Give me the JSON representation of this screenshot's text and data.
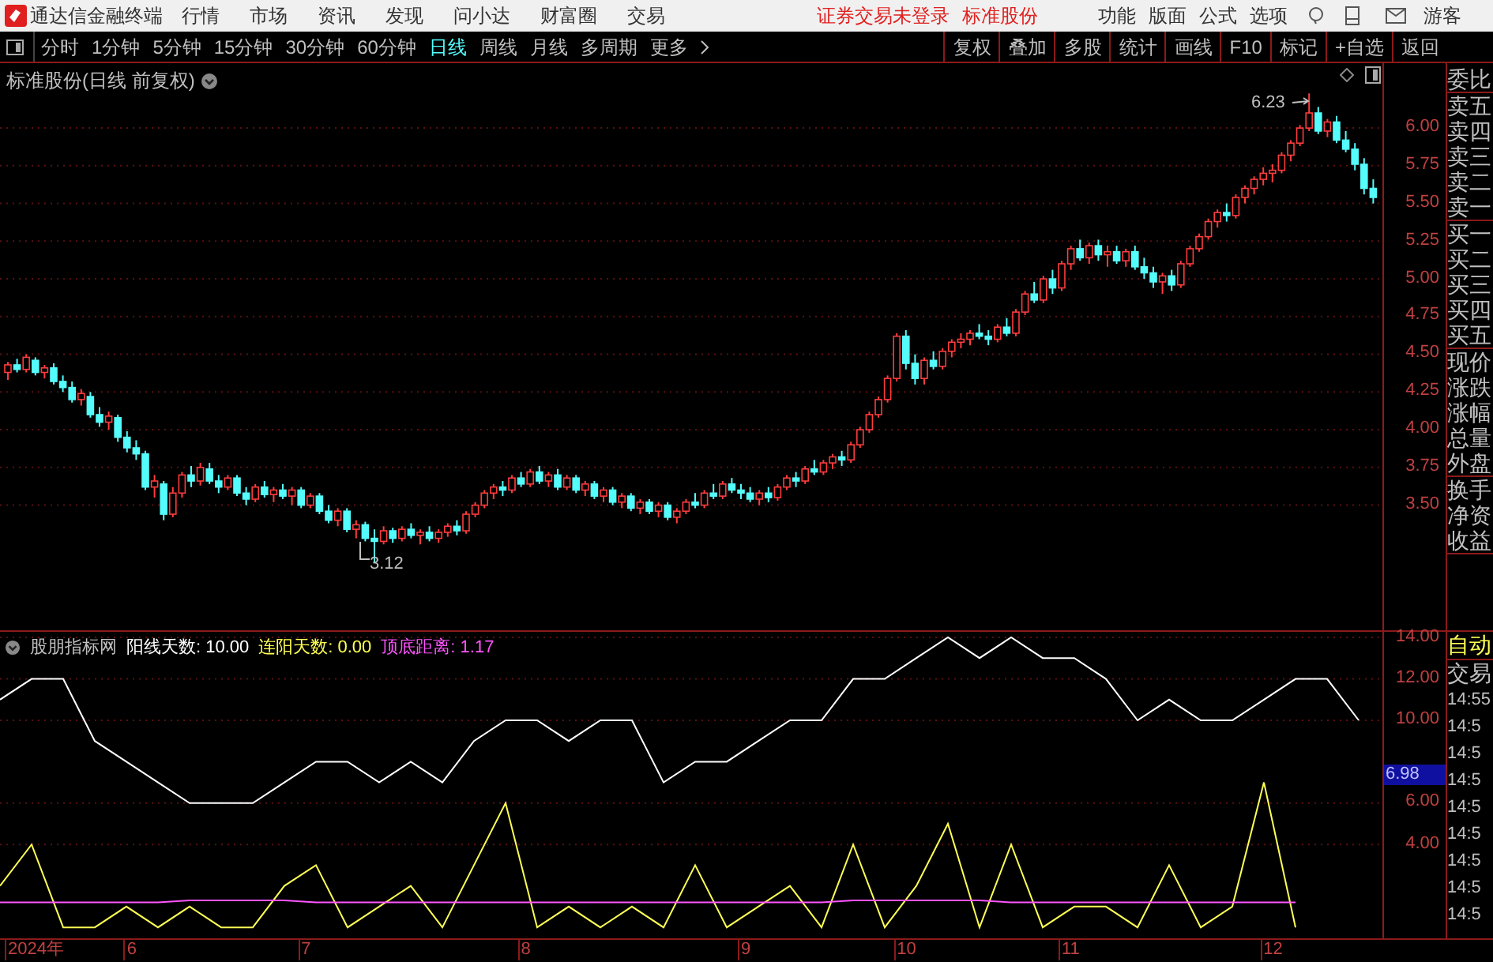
{
  "app": {
    "title": "通达信金融终端"
  },
  "menu": [
    "行情",
    "市场",
    "资讯",
    "发现",
    "问小达",
    "财富圈",
    "交易"
  ],
  "status": [
    "证券交易未登录",
    "标准股份"
  ],
  "right_menu": [
    "功能",
    "版面",
    "公式",
    "选项"
  ],
  "user": "游客",
  "periods": [
    {
      "label": "分时",
      "selected": false
    },
    {
      "label": "1分钟",
      "selected": false
    },
    {
      "label": "5分钟",
      "selected": false
    },
    {
      "label": "15分钟",
      "selected": false
    },
    {
      "label": "30分钟",
      "selected": false
    },
    {
      "label": "60分钟",
      "selected": false
    },
    {
      "label": "日线",
      "selected": true
    },
    {
      "label": "周线",
      "selected": false
    },
    {
      "label": "月线",
      "selected": false
    },
    {
      "label": "多周期",
      "selected": false
    },
    {
      "label": "更多",
      "selected": false
    }
  ],
  "toolbar_buttons": [
    "复权",
    "叠加",
    "多股",
    "统计",
    "画线",
    "F10",
    "标记",
    "+自选",
    "返回"
  ],
  "chart": {
    "title": "标准股份(日线 前复权)",
    "high_label": "6.23",
    "low_label": "3.12",
    "chart_data": {
      "type": "candlestick",
      "ylim": [
        2.66,
        6.43
      ],
      "grid": true,
      "yticks": [
        {
          "value": 6,
          "label": "6.00"
        },
        {
          "value": 5.75,
          "label": "5.75"
        },
        {
          "value": 5.5,
          "label": "5.50"
        },
        {
          "value": 5.25,
          "label": "5.25"
        },
        {
          "value": 5,
          "label": "5.00"
        },
        {
          "value": 4.75,
          "label": "4.75"
        },
        {
          "value": 4.5,
          "label": "4.50"
        },
        {
          "value": 4.25,
          "label": "4.25"
        },
        {
          "value": 4,
          "label": "4.00"
        },
        {
          "value": 3.75,
          "label": "3.75"
        },
        {
          "value": 3.5,
          "label": "3.50"
        }
      ],
      "ohlc": [
        [
          4.38,
          4.45,
          4.33,
          4.43
        ],
        [
          4.43,
          4.47,
          4.38,
          4.4
        ],
        [
          4.4,
          4.5,
          4.38,
          4.48
        ],
        [
          4.46,
          4.48,
          4.36,
          4.38
        ],
        [
          4.38,
          4.43,
          4.34,
          4.41
        ],
        [
          4.41,
          4.44,
          4.3,
          4.32
        ],
        [
          4.32,
          4.36,
          4.25,
          4.28
        ],
        [
          4.28,
          4.32,
          4.18,
          4.2
        ],
        [
          4.2,
          4.27,
          4.16,
          4.24
        ],
        [
          4.22,
          4.25,
          4.08,
          4.1
        ],
        [
          4.1,
          4.15,
          4.02,
          4.05
        ],
        [
          4.05,
          4.12,
          4.0,
          4.09
        ],
        [
          4.08,
          4.1,
          3.92,
          3.95
        ],
        [
          3.95,
          3.99,
          3.85,
          3.88
        ],
        [
          3.88,
          3.93,
          3.8,
          3.84
        ],
        [
          3.84,
          3.86,
          3.6,
          3.62
        ],
        [
          3.62,
          3.7,
          3.55,
          3.66
        ],
        [
          3.64,
          3.66,
          3.4,
          3.44
        ],
        [
          3.44,
          3.62,
          3.42,
          3.58
        ],
        [
          3.58,
          3.72,
          3.55,
          3.7
        ],
        [
          3.7,
          3.76,
          3.62,
          3.66
        ],
        [
          3.66,
          3.78,
          3.63,
          3.75
        ],
        [
          3.74,
          3.78,
          3.64,
          3.66
        ],
        [
          3.66,
          3.7,
          3.58,
          3.62
        ],
        [
          3.62,
          3.7,
          3.6,
          3.68
        ],
        [
          3.68,
          3.7,
          3.56,
          3.58
        ],
        [
          3.58,
          3.62,
          3.5,
          3.54
        ],
        [
          3.54,
          3.64,
          3.52,
          3.62
        ],
        [
          3.62,
          3.66,
          3.55,
          3.57
        ],
        [
          3.57,
          3.62,
          3.52,
          3.6
        ],
        [
          3.6,
          3.64,
          3.54,
          3.56
        ],
        [
          3.56,
          3.62,
          3.5,
          3.6
        ],
        [
          3.6,
          3.62,
          3.48,
          3.5
        ],
        [
          3.5,
          3.58,
          3.48,
          3.56
        ],
        [
          3.56,
          3.58,
          3.44,
          3.46
        ],
        [
          3.46,
          3.5,
          3.38,
          3.4
        ],
        [
          3.4,
          3.48,
          3.36,
          3.46
        ],
        [
          3.46,
          3.48,
          3.32,
          3.34
        ],
        [
          3.34,
          3.4,
          3.28,
          3.37
        ],
        [
          3.37,
          3.39,
          3.26,
          3.28
        ],
        [
          3.28,
          3.34,
          3.12,
          3.26
        ],
        [
          3.26,
          3.36,
          3.24,
          3.33
        ],
        [
          3.33,
          3.35,
          3.25,
          3.28
        ],
        [
          3.28,
          3.36,
          3.26,
          3.34
        ],
        [
          3.34,
          3.38,
          3.28,
          3.3
        ],
        [
          3.3,
          3.34,
          3.24,
          3.32
        ],
        [
          3.32,
          3.36,
          3.26,
          3.28
        ],
        [
          3.28,
          3.34,
          3.25,
          3.32
        ],
        [
          3.32,
          3.38,
          3.29,
          3.36
        ],
        [
          3.36,
          3.4,
          3.3,
          3.33
        ],
        [
          3.33,
          3.46,
          3.31,
          3.44
        ],
        [
          3.44,
          3.52,
          3.42,
          3.5
        ],
        [
          3.5,
          3.6,
          3.48,
          3.58
        ],
        [
          3.58,
          3.64,
          3.54,
          3.62
        ],
        [
          3.62,
          3.66,
          3.56,
          3.6
        ],
        [
          3.6,
          3.7,
          3.58,
          3.68
        ],
        [
          3.68,
          3.72,
          3.62,
          3.64
        ],
        [
          3.64,
          3.74,
          3.62,
          3.72
        ],
        [
          3.72,
          3.76,
          3.64,
          3.66
        ],
        [
          3.66,
          3.72,
          3.62,
          3.7
        ],
        [
          3.7,
          3.74,
          3.6,
          3.62
        ],
        [
          3.62,
          3.7,
          3.6,
          3.68
        ],
        [
          3.68,
          3.7,
          3.58,
          3.6
        ],
        [
          3.6,
          3.66,
          3.56,
          3.64
        ],
        [
          3.64,
          3.66,
          3.54,
          3.56
        ],
        [
          3.56,
          3.62,
          3.52,
          3.6
        ],
        [
          3.6,
          3.62,
          3.5,
          3.52
        ],
        [
          3.52,
          3.58,
          3.48,
          3.56
        ],
        [
          3.56,
          3.58,
          3.46,
          3.48
        ],
        [
          3.48,
          3.54,
          3.44,
          3.52
        ],
        [
          3.52,
          3.54,
          3.44,
          3.46
        ],
        [
          3.46,
          3.52,
          3.42,
          3.5
        ],
        [
          3.5,
          3.52,
          3.4,
          3.42
        ],
        [
          3.42,
          3.48,
          3.38,
          3.46
        ],
        [
          3.46,
          3.54,
          3.44,
          3.52
        ],
        [
          3.52,
          3.58,
          3.48,
          3.5
        ],
        [
          3.5,
          3.6,
          3.48,
          3.58
        ],
        [
          3.58,
          3.64,
          3.54,
          3.56
        ],
        [
          3.56,
          3.66,
          3.54,
          3.64
        ],
        [
          3.64,
          3.68,
          3.58,
          3.6
        ],
        [
          3.6,
          3.64,
          3.54,
          3.58
        ],
        [
          3.58,
          3.62,
          3.52,
          3.54
        ],
        [
          3.54,
          3.6,
          3.5,
          3.58
        ],
        [
          3.58,
          3.62,
          3.52,
          3.55
        ],
        [
          3.55,
          3.64,
          3.53,
          3.62
        ],
        [
          3.62,
          3.7,
          3.6,
          3.68
        ],
        [
          3.68,
          3.72,
          3.62,
          3.66
        ],
        [
          3.66,
          3.76,
          3.64,
          3.74
        ],
        [
          3.74,
          3.8,
          3.7,
          3.72
        ],
        [
          3.72,
          3.8,
          3.7,
          3.78
        ],
        [
          3.78,
          3.84,
          3.74,
          3.82
        ],
        [
          3.82,
          3.86,
          3.76,
          3.8
        ],
        [
          3.8,
          3.92,
          3.78,
          3.9
        ],
        [
          3.9,
          4.02,
          3.88,
          4.0
        ],
        [
          4.0,
          4.12,
          3.98,
          4.1
        ],
        [
          4.1,
          4.22,
          4.08,
          4.2
        ],
        [
          4.2,
          4.36,
          4.18,
          4.34
        ],
        [
          4.34,
          4.64,
          4.32,
          4.62
        ],
        [
          4.62,
          4.66,
          4.4,
          4.44
        ],
        [
          4.44,
          4.5,
          4.3,
          4.34
        ],
        [
          4.34,
          4.48,
          4.3,
          4.46
        ],
        [
          4.46,
          4.52,
          4.4,
          4.42
        ],
        [
          4.42,
          4.54,
          4.4,
          4.52
        ],
        [
          4.52,
          4.6,
          4.48,
          4.58
        ],
        [
          4.58,
          4.64,
          4.54,
          4.6
        ],
        [
          4.6,
          4.66,
          4.56,
          4.64
        ],
        [
          4.64,
          4.7,
          4.6,
          4.62
        ],
        [
          4.62,
          4.66,
          4.56,
          4.6
        ],
        [
          4.6,
          4.7,
          4.58,
          4.68
        ],
        [
          4.68,
          4.74,
          4.62,
          4.64
        ],
        [
          4.64,
          4.8,
          4.62,
          4.78
        ],
        [
          4.78,
          4.92,
          4.76,
          4.9
        ],
        [
          4.9,
          4.98,
          4.84,
          4.86
        ],
        [
          4.86,
          5.02,
          4.84,
          5.0
        ],
        [
          5.0,
          5.06,
          4.9,
          4.94
        ],
        [
          4.94,
          5.12,
          4.92,
          5.1
        ],
        [
          5.1,
          5.22,
          5.06,
          5.2
        ],
        [
          5.2,
          5.26,
          5.12,
          5.14
        ],
        [
          5.14,
          5.24,
          5.1,
          5.22
        ],
        [
          5.22,
          5.26,
          5.12,
          5.16
        ],
        [
          5.16,
          5.22,
          5.08,
          5.18
        ],
        [
          5.18,
          5.22,
          5.1,
          5.12
        ],
        [
          5.12,
          5.2,
          5.08,
          5.18
        ],
        [
          5.18,
          5.22,
          5.06,
          5.08
        ],
        [
          5.08,
          5.14,
          5.0,
          5.04
        ],
        [
          5.04,
          5.08,
          4.94,
          4.98
        ],
        [
          4.98,
          5.04,
          4.9,
          5.02
        ],
        [
          5.02,
          5.06,
          4.92,
          4.96
        ],
        [
          4.96,
          5.12,
          4.94,
          5.1
        ],
        [
          5.1,
          5.22,
          5.08,
          5.2
        ],
        [
          5.2,
          5.3,
          5.18,
          5.28
        ],
        [
          5.28,
          5.4,
          5.26,
          5.38
        ],
        [
          5.38,
          5.46,
          5.34,
          5.44
        ],
        [
          5.44,
          5.5,
          5.38,
          5.42
        ],
        [
          5.42,
          5.56,
          5.4,
          5.54
        ],
        [
          5.54,
          5.62,
          5.5,
          5.6
        ],
        [
          5.6,
          5.68,
          5.56,
          5.66
        ],
        [
          5.66,
          5.74,
          5.62,
          5.7
        ],
        [
          5.7,
          5.76,
          5.64,
          5.72
        ],
        [
          5.72,
          5.84,
          5.7,
          5.82
        ],
        [
          5.82,
          5.92,
          5.78,
          5.9
        ],
        [
          5.9,
          6.02,
          5.88,
          6.0
        ],
        [
          6.0,
          6.23,
          5.98,
          6.1
        ],
        [
          6.1,
          6.14,
          5.96,
          5.98
        ],
        [
          5.98,
          6.06,
          5.94,
          6.04
        ],
        [
          6.04,
          6.08,
          5.9,
          5.92
        ],
        [
          5.92,
          5.98,
          5.84,
          5.86
        ],
        [
          5.86,
          5.9,
          5.72,
          5.76
        ],
        [
          5.76,
          5.8,
          5.56,
          5.6
        ],
        [
          5.6,
          5.66,
          5.5,
          5.54
        ]
      ]
    }
  },
  "indicator": {
    "name": "股朋指标网",
    "legend": [
      {
        "label": "阳线天数: 10.00",
        "color": "#ffffff"
      },
      {
        "label": "连阳天数: 0.00",
        "color": "#ffff54"
      },
      {
        "label": "顶底距离: 1.17",
        "color": "#ff54ff"
      }
    ],
    "current": "6.98",
    "chart_data": {
      "type": "line",
      "ylim": [
        -0.53,
        14.27
      ],
      "grid": true,
      "yticks": [
        {
          "value": 14,
          "label": "14.00"
        },
        {
          "value": 12,
          "label": "12.00"
        },
        {
          "value": 10,
          "label": "10.00"
        },
        {
          "value": 6,
          "label": "6.00"
        },
        {
          "value": 4,
          "label": "4.00"
        }
      ],
      "series": [
        {
          "color": "#ffffff",
          "values": [
            11,
            12,
            12,
            9,
            8,
            7,
            6,
            6,
            6,
            7,
            8,
            8,
            7,
            8,
            7,
            9,
            10,
            10,
            9,
            10,
            10,
            7,
            8,
            8,
            9,
            10,
            10,
            12,
            12,
            13,
            14,
            13,
            14,
            13,
            13,
            12,
            10,
            11,
            10,
            10,
            11,
            12,
            12,
            10
          ]
        },
        {
          "color": "#ffff54",
          "values": [
            2,
            4,
            0,
            0,
            1,
            0,
            1,
            0,
            0,
            2,
            3,
            0,
            1,
            2,
            0,
            3,
            6,
            0,
            1,
            0,
            1,
            0,
            3,
            0,
            1,
            2,
            0,
            4,
            0,
            2,
            5,
            0,
            4,
            0,
            1,
            1,
            0,
            3,
            0,
            1,
            7,
            0,
            null,
            null
          ]
        },
        {
          "color": "#ff54ff",
          "values": [
            1.2,
            1.2,
            1.2,
            1.2,
            1.2,
            1.2,
            1.3,
            1.3,
            1.3,
            1.3,
            1.2,
            1.2,
            1.2,
            1.2,
            1.2,
            1.2,
            1.2,
            1.2,
            1.2,
            1.2,
            1.2,
            1.2,
            1.2,
            1.2,
            1.2,
            1.2,
            1.2,
            1.3,
            1.3,
            1.3,
            1.3,
            1.3,
            1.2,
            1.2,
            1.2,
            1.2,
            1.2,
            1.2,
            1.2,
            1.2,
            1.2,
            1.2,
            null,
            null
          ]
        }
      ]
    }
  },
  "x_axis": [
    "2024年",
    "6",
    "7",
    "8",
    "9",
    "10",
    "11",
    "12"
  ],
  "side_panel": {
    "groups": [
      [
        "委比"
      ],
      [
        "卖五",
        "卖四",
        "卖三",
        "卖二",
        "卖一"
      ],
      [
        "买一",
        "买二",
        "买三",
        "买四",
        "买五"
      ],
      [
        "现价",
        "涨跌",
        "涨幅",
        "总量",
        "外盘"
      ],
      [
        "换手",
        "净资",
        "收益"
      ]
    ],
    "auto": "自动",
    "trade": "交易",
    "times": [
      "14:55",
      "14:5",
      "14:5",
      "14:5",
      "14:5",
      "14:5",
      "14:5",
      "14:5",
      "14:5"
    ]
  }
}
